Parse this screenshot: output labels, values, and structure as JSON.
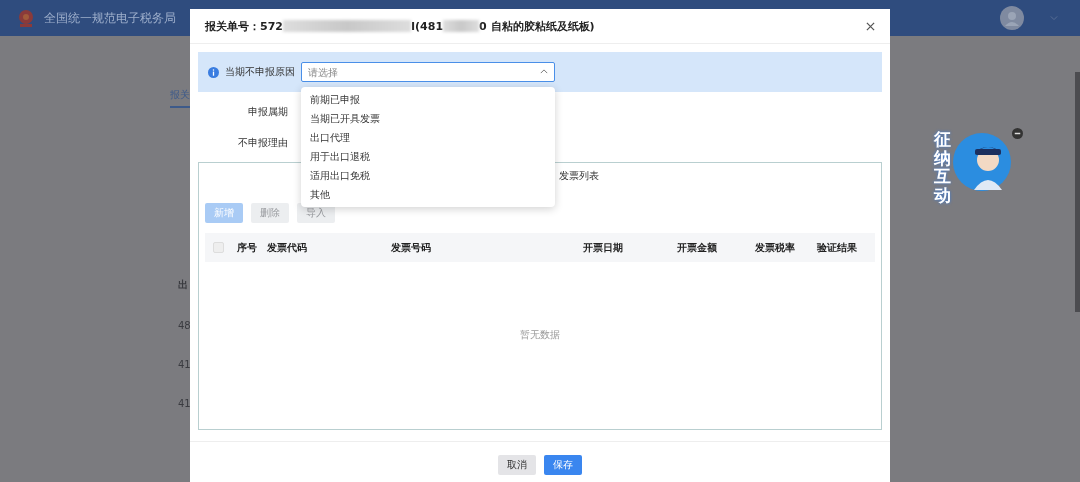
{
  "page": {
    "site_title": "全国统一规范电子税务局",
    "background_texts": [
      {
        "kind": "tab",
        "text": "报关"
      },
      {
        "kind": "heading",
        "text": "出"
      },
      {
        "kind": "row",
        "text": "48"
      },
      {
        "kind": "row",
        "text": "41"
      },
      {
        "kind": "row",
        "text": "41"
      }
    ]
  },
  "dialog": {
    "title_parts": [
      {
        "kind": "text",
        "text": "报关单号：572"
      },
      {
        "kind": "redacted"
      },
      {
        "kind": "text",
        "text": "I(481"
      },
      {
        "kind": "redacted"
      },
      {
        "kind": "text",
        "text": "0 自粘的胶粘纸及纸板)"
      }
    ],
    "reason": {
      "label": "当期不申报原因",
      "placeholder": "请选择",
      "expanded": true,
      "options": [
        {
          "label": "前期已申报",
          "selected": false
        },
        {
          "label": "当期已开具发票",
          "selected": false
        },
        {
          "label": "出口代理",
          "selected": false
        },
        {
          "label": "用于出口退税",
          "selected": false
        },
        {
          "label": "适用出口免税",
          "selected": false
        },
        {
          "label": "其他",
          "selected": false
        }
      ]
    },
    "fields": [
      {
        "label": "申报属期"
      },
      {
        "label": "不申报理由"
      }
    ],
    "invoice_panel": {
      "title": "发票列表",
      "buttons": [
        {
          "label": "新增",
          "kind": "primary",
          "disabled": true
        },
        {
          "label": "删除",
          "kind": "default",
          "disabled": true
        },
        {
          "label": "导入",
          "kind": "default",
          "disabled": true
        }
      ],
      "columns": [
        "序号",
        "发票代码",
        "发票号码",
        "开票日期",
        "开票金额",
        "发票税率",
        "验证结果"
      ],
      "select_all": {
        "checked": false,
        "disabled": true
      },
      "empty_text": "暂无数据"
    },
    "footer_buttons": [
      {
        "label": "取消",
        "kind": "default"
      },
      {
        "label": "保存",
        "kind": "primary"
      }
    ]
  },
  "mascot": {
    "text": "征纳互动"
  }
}
